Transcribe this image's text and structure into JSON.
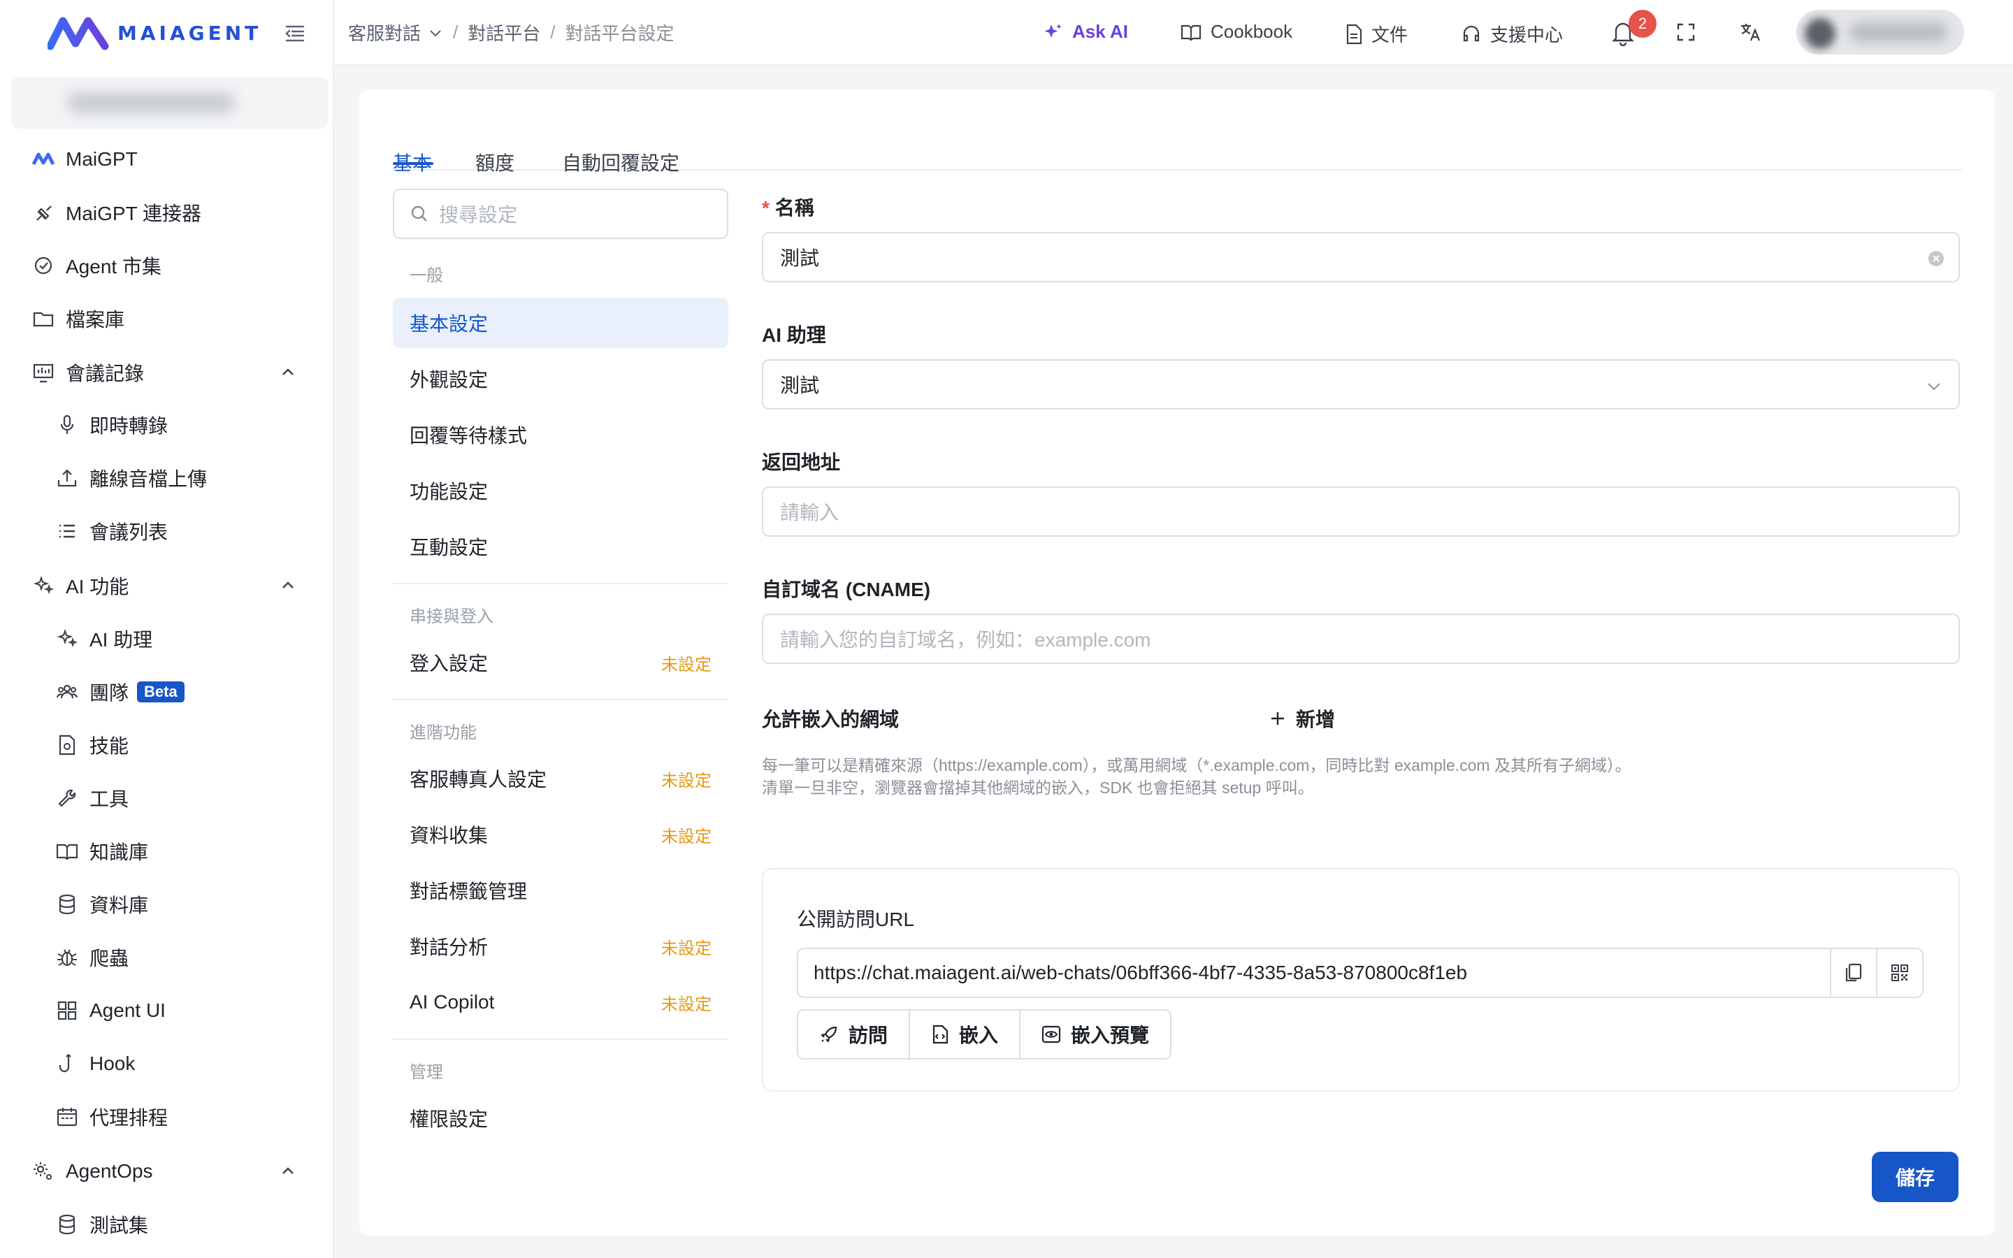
{
  "brand": {
    "name": "MAIAGENT",
    "accent": "#2450d8"
  },
  "sidebar": {
    "items": [
      {
        "label": "MaiGPT",
        "icon": "maiagent-logo-icon"
      },
      {
        "label": "MaiGPT 連接器",
        "icon": "connector-icon"
      },
      {
        "label": "Agent 市集",
        "icon": "marketplace-icon"
      },
      {
        "label": "檔案庫",
        "icon": "folder-icon"
      },
      {
        "label": "會議記錄",
        "icon": "meeting-icon",
        "expanded": true
      },
      {
        "label": "即時轉錄",
        "icon": "microphone-icon"
      },
      {
        "label": "離線音檔上傳",
        "icon": "upload-icon"
      },
      {
        "label": "會議列表",
        "icon": "list-icon"
      },
      {
        "label": "AI 功能",
        "icon": "sparkles-icon",
        "expanded": true
      },
      {
        "label": "AI 助理",
        "icon": "sparkles-icon"
      },
      {
        "label": "團隊",
        "icon": "team-icon",
        "badge": "Beta"
      },
      {
        "label": "技能",
        "icon": "skill-file-icon"
      },
      {
        "label": "工具",
        "icon": "wrench-icon"
      },
      {
        "label": "知識庫",
        "icon": "book-icon"
      },
      {
        "label": "資料庫",
        "icon": "database-icon"
      },
      {
        "label": "爬蟲",
        "icon": "bug-icon"
      },
      {
        "label": "Agent UI",
        "icon": "grid-icon"
      },
      {
        "label": "Hook",
        "icon": "hook-icon"
      },
      {
        "label": "代理排程",
        "icon": "calendar-icon"
      },
      {
        "label": "AgentOps",
        "icon": "gear-group-icon",
        "expanded": true
      },
      {
        "label": "測試集",
        "icon": "database-icon"
      }
    ]
  },
  "header": {
    "breadcrumbs": [
      "客服對話",
      "對話平台",
      "對話平台設定"
    ],
    "ask_ai": "Ask AI",
    "cookbook": "Cookbook",
    "docs": "文件",
    "support": "支援中心",
    "notification_count": "2"
  },
  "tabs": [
    {
      "label": "基本",
      "active": true
    },
    {
      "label": "額度"
    },
    {
      "label": "自動回覆設定"
    }
  ],
  "settings_nav": {
    "search_placeholder": "搜尋設定",
    "groups": {
      "general": "一般",
      "integration": "串接與登入",
      "advanced": "進階功能",
      "admin": "管理"
    },
    "unset_label": "未設定",
    "items": {
      "basic": "基本設定",
      "appearance": "外觀設定",
      "reply_wait": "回覆等待樣式",
      "features": "功能設定",
      "interaction": "互動設定",
      "login": "登入設定",
      "human_handoff": "客服轉真人設定",
      "data_collection": "資料收集",
      "tag_management": "對話標籤管理",
      "analytics": "對話分析",
      "copilot": "AI Copilot",
      "permissions": "權限設定"
    }
  },
  "form": {
    "name_label": "名稱",
    "name_value": "測試",
    "assistant_label": "AI 助理",
    "assistant_value": "測試",
    "return_label": "返回地址",
    "return_placeholder": "請輸入",
    "cname_label": "自訂域名 (CNAME)",
    "cname_placeholder": "請輸入您的自訂域名，例如：example.com",
    "embed_label": "允許嵌入的網域",
    "add_label": "新增",
    "hint_line1": "每一筆可以是精確來源（https://example.com），或萬用網域（*.example.com，同時比對 example.com 及其所有子網域）。",
    "hint_line2": "清單一旦非空，瀏覽器會擋掉其他網域的嵌入，SDK 也會拒絕其 setup 呼叫。"
  },
  "public_url": {
    "title": "公開訪問URL",
    "url": "https://chat.maiagent.ai/web-chats/06bff366-4bf7-4335-8a53-870800c8f1eb",
    "visit": "訪問",
    "embed": "嵌入",
    "embed_preview": "嵌入預覽"
  },
  "save_label": "儲存"
}
